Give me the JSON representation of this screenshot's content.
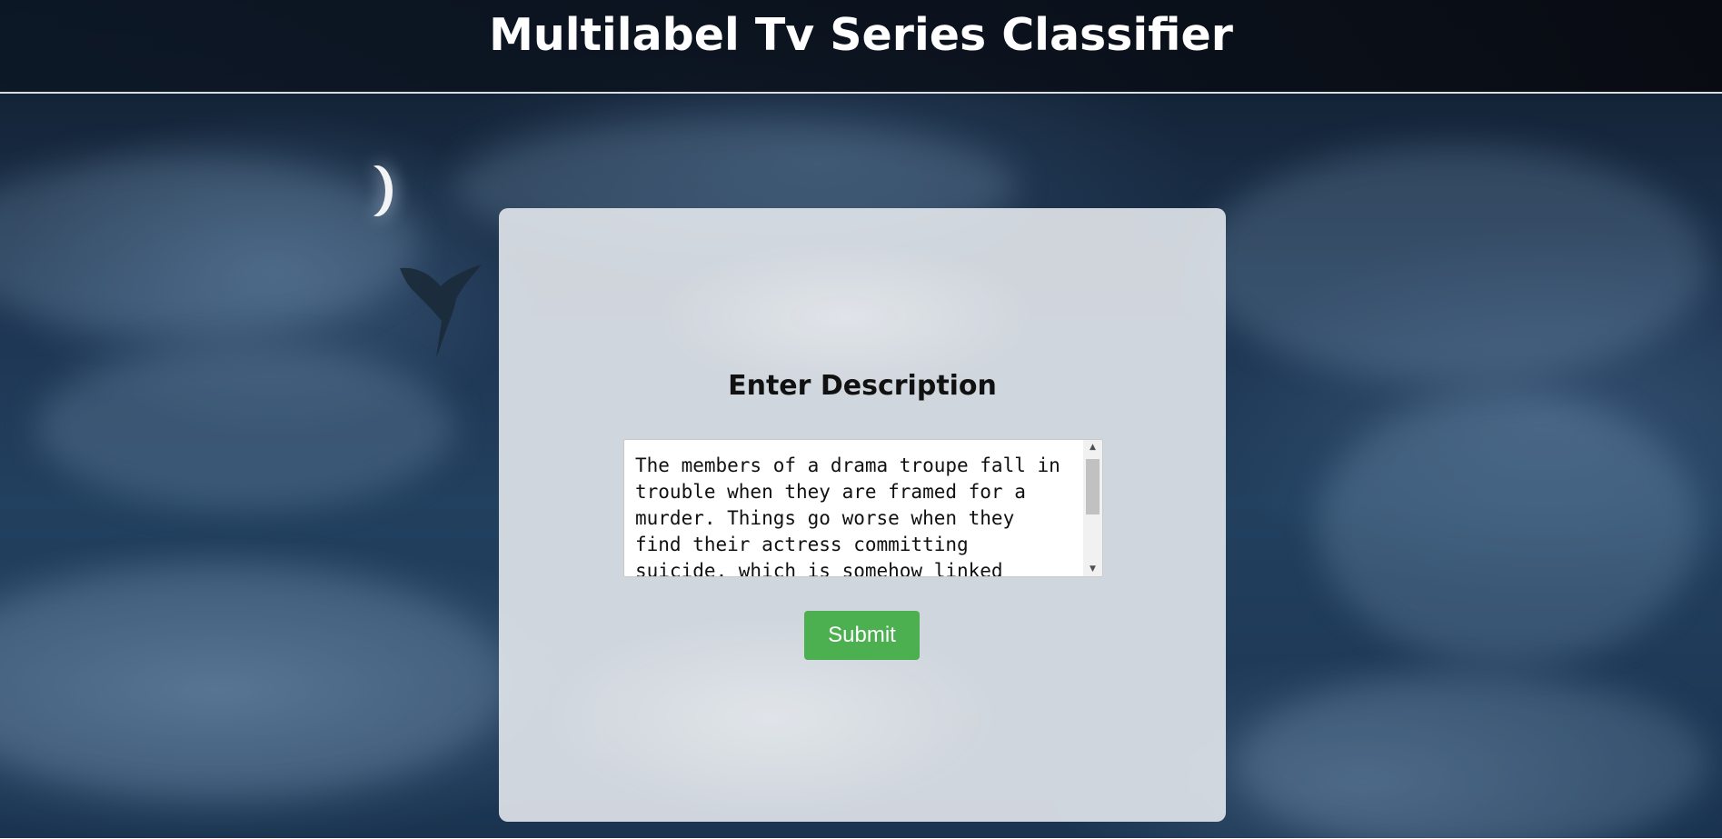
{
  "header": {
    "title": "Multilabel Tv Series Classifier"
  },
  "form": {
    "heading": "Enter Description",
    "description_value": "The members of a drama troupe fall in trouble when they are framed for a murder. Things go worse when they find their actress committing suicide, which is somehow linked",
    "submit_label": "Submit"
  },
  "scrollbar": {
    "up_glyph": "▲",
    "down_glyph": "▼",
    "position_fraction": 0.0
  },
  "colors": {
    "submit_button": "#4caf50",
    "card_background": "#dee2e7",
    "header_background": "#0c1624",
    "title_text": "#ffffff"
  },
  "icons": {
    "background": "night-sky-clouds-image",
    "moon": "crescent-moon-icon",
    "dragon": "dragon-silhouette-icon"
  }
}
